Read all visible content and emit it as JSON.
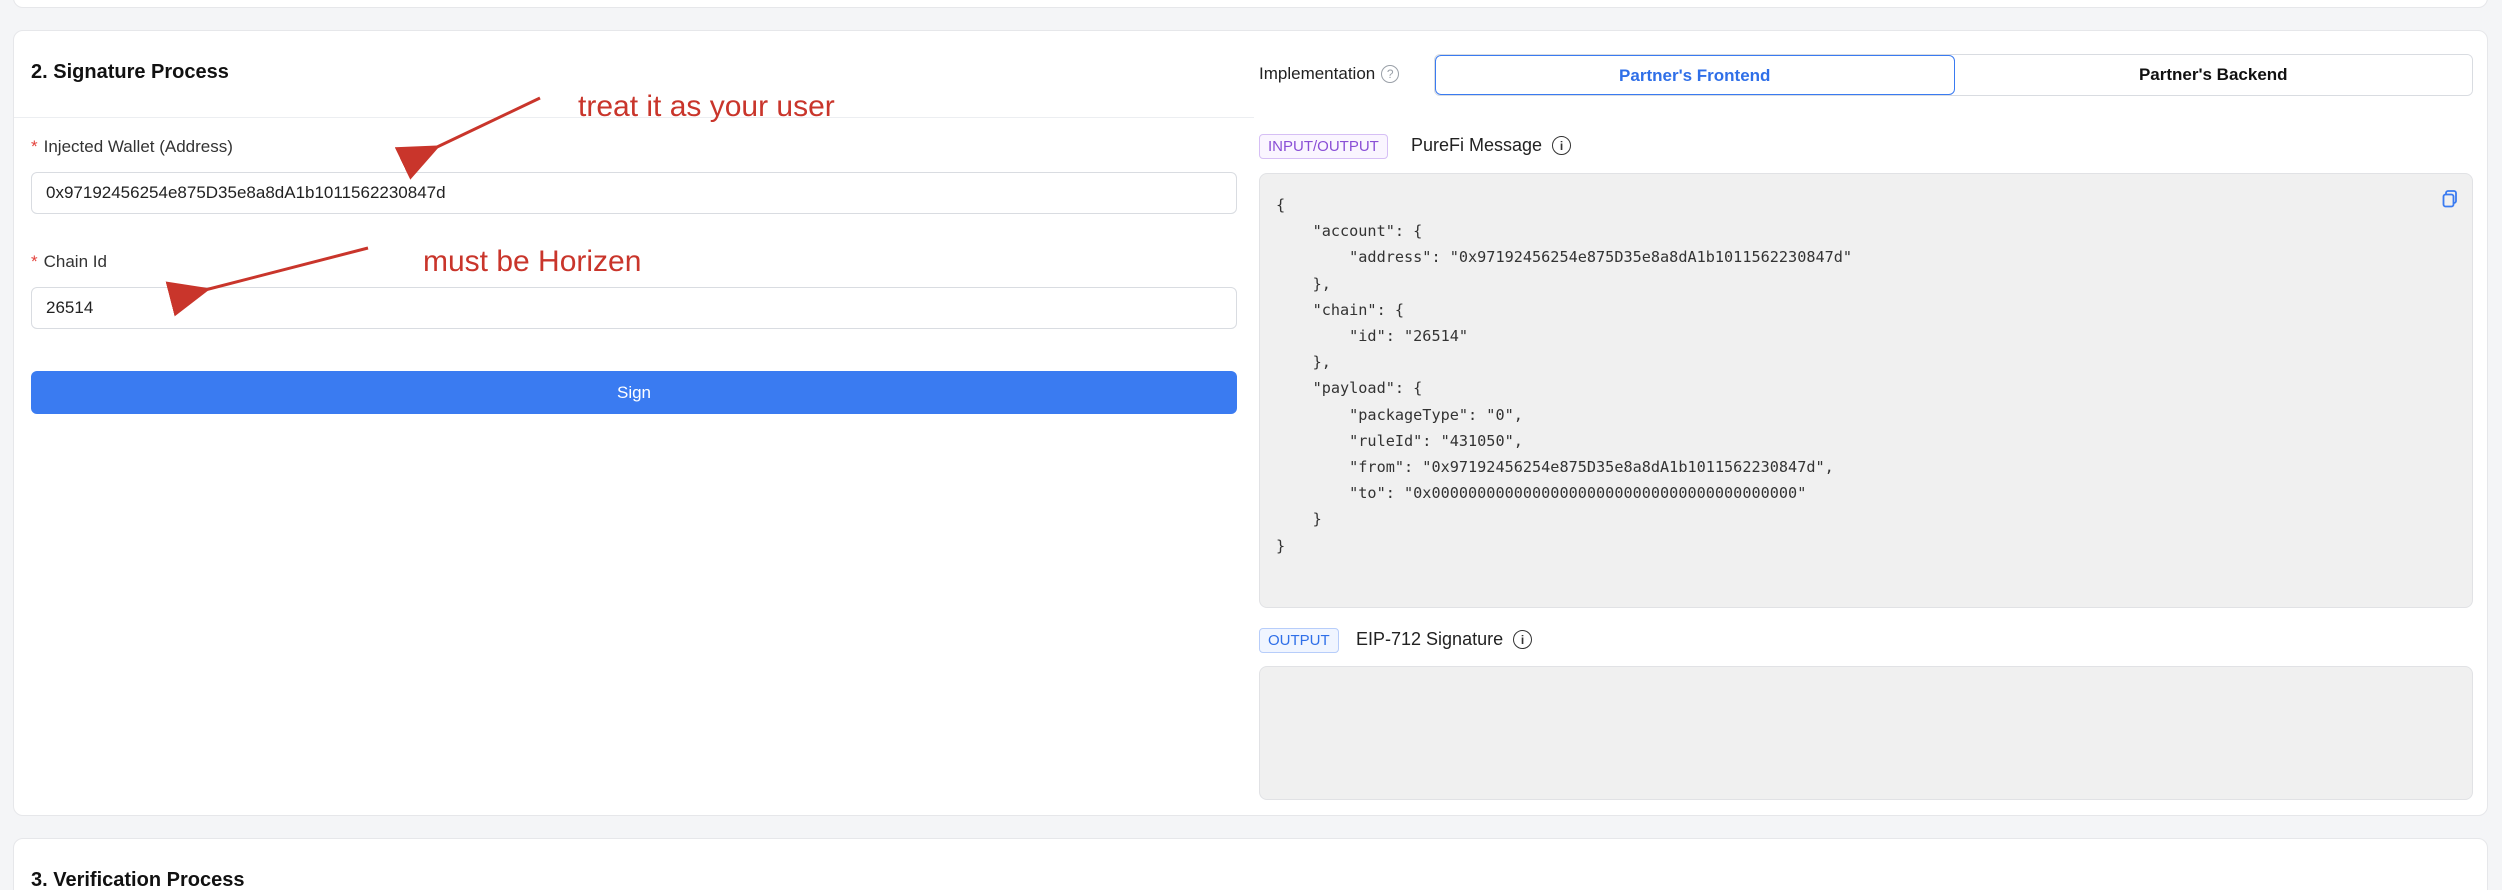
{
  "signature_section": {
    "title": "2. Signature Process",
    "wallet_label": "Injected Wallet (Address)",
    "wallet_value": "0x97192456254e875D35e8a8dA1b1011562230847d",
    "chain_label": "Chain Id",
    "chain_value": "26514",
    "sign_button": "Sign",
    "required_mark": "*"
  },
  "annotations": {
    "wallet_note": "treat it as your user",
    "chain_note": "must be Horizen",
    "color": "#c9352b"
  },
  "implementation": {
    "label": "Implementation",
    "help_icon": "question-circle-icon",
    "options": [
      "Partner's Frontend",
      "Partner's Backend"
    ],
    "selected": "Partner's Frontend"
  },
  "message": {
    "tag": "INPUT/OUTPUT",
    "title": "PureFi Message",
    "info_icon": "info-circle-icon",
    "copy_icon": "copy-icon",
    "code": "{\n    \"account\": {\n        \"address\": \"0x97192456254e875D35e8a8dA1b1011562230847d\"\n    },\n    \"chain\": {\n        \"id\": \"26514\"\n    },\n    \"payload\": {\n        \"packageType\": \"0\",\n        \"ruleId\": \"431050\",\n        \"from\": \"0x97192456254e875D35e8a8dA1b1011562230847d\",\n        \"to\": \"0x0000000000000000000000000000000000000000\"\n    }\n}"
  },
  "signature": {
    "tag": "OUTPUT",
    "title": "EIP-712 Signature",
    "info_icon": "info-circle-icon",
    "value": ""
  },
  "verification_section": {
    "title": "3. Verification Process"
  },
  "colors": {
    "primary": "#3a7bf1",
    "required": "#e3413b",
    "tag_purple": "#8a4fd6",
    "tag_blue": "#2f6fe8"
  }
}
